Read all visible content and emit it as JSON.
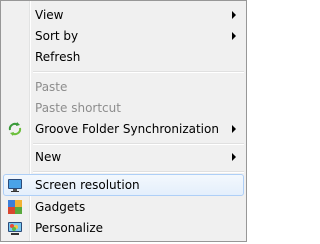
{
  "menu": {
    "items": [
      {
        "label": "View",
        "submenu": true
      },
      {
        "label": "Sort by",
        "submenu": true
      },
      {
        "label": "Refresh"
      },
      {
        "label": "Paste",
        "disabled": true
      },
      {
        "label": "Paste shortcut",
        "disabled": true
      },
      {
        "label": "Groove Folder Synchronization",
        "submenu": true,
        "icon": "groove-sync-icon"
      },
      {
        "label": "New",
        "submenu": true
      },
      {
        "label": "Screen resolution",
        "icon": "monitor-icon",
        "highlighted": true
      },
      {
        "label": "Gadgets",
        "icon": "gadgets-icon"
      },
      {
        "label": "Personalize",
        "icon": "personalize-icon"
      }
    ]
  },
  "colors": {
    "highlight_border": "#aecff7",
    "disabled_text": "#8d8d8d"
  }
}
